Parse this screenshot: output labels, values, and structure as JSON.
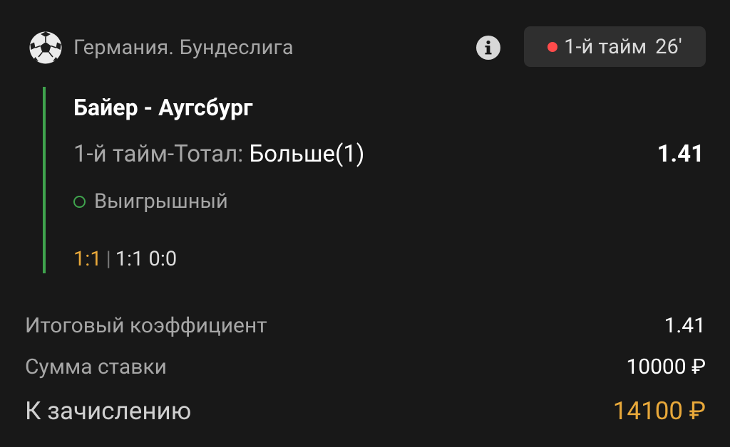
{
  "header": {
    "league": "Германия. Бундеслига",
    "league_icon": "soccer-ball-icon",
    "info_icon": "info-icon",
    "live": {
      "period": "1-й тайм",
      "minute": "26'",
      "dot_color": "#ff4b4b"
    }
  },
  "bet": {
    "match": "Байер - Аугсбург",
    "market_label": "1-й тайм-Тотал: ",
    "market_value": "Больше(1)",
    "odds": "1.41",
    "status": "Выигрышный",
    "status_color": "#3fa34d",
    "score_current": "1:1",
    "score_separator": "|",
    "score_details": "1:1 0:0"
  },
  "summary": {
    "total_odds_label": "Итоговый коэффициент",
    "total_odds_value": "1.41",
    "stake_label": "Сумма ставки",
    "stake_value": "10000 ₽",
    "payout_label": "К зачислению",
    "payout_value": "14100 ₽",
    "payout_color": "#e8a83a"
  }
}
